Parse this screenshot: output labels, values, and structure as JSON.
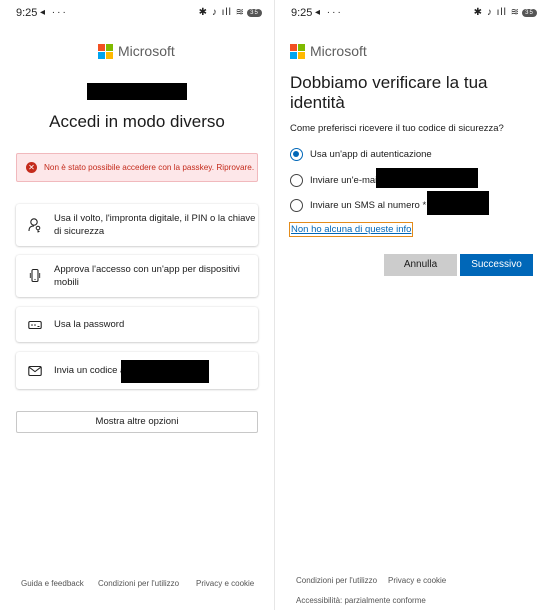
{
  "left": {
    "status": {
      "time": "9:25",
      "left_icons": "◂ ···",
      "right_icons": "✱ ♪ ıll ≋",
      "battery": "35"
    },
    "logo_text": "Microsoft",
    "title": "Accedi in modo diverso",
    "error": "Non è stato possibile accedere con la passkey. Riprovare.",
    "options": [
      {
        "label": "Usa il volto, l'impronta digitale, il PIN o la chiave di sicurezza",
        "icon": "face-key-icon"
      },
      {
        "label": "Approva l'accesso con un'app per dispositivi mobili",
        "icon": "phone-icon"
      },
      {
        "label": "Usa la password",
        "icon": "password-icon"
      },
      {
        "label": "Invia un codice a",
        "icon": "mail-icon"
      }
    ],
    "more_options": "Mostra altre opzioni",
    "footer": [
      "Guida e feedback",
      "Condizioni per l'utilizzo",
      "Privacy e cookie"
    ]
  },
  "right": {
    "status": {
      "time": "9:25",
      "left_icons": "◂ ···",
      "right_icons": "✱ ♪ ıll ≋",
      "battery": "35"
    },
    "logo_text": "Microsoft",
    "title": "Dobbiamo verificare la tua identità",
    "question": "Come preferisci ricevere il tuo codice di sicurezza?",
    "radios": [
      {
        "label": "Usa un'app di autenticazione",
        "checked": true
      },
      {
        "label": "Inviare un'e-mail a",
        "checked": false
      },
      {
        "label": "Inviare un SMS al numero *",
        "checked": false
      }
    ],
    "no_info_link": "Non ho alcuna di queste info",
    "cancel_button": "Annulla",
    "next_button": "Successivo",
    "footer": [
      "Condizioni per l'utilizzo",
      "Privacy e cookie"
    ],
    "accessibility": "Accessibilità: parzialmente conforme"
  },
  "colors": {
    "accent": "#0067b8",
    "error": "#c42b1c",
    "link_focus": "#e38b1a"
  }
}
